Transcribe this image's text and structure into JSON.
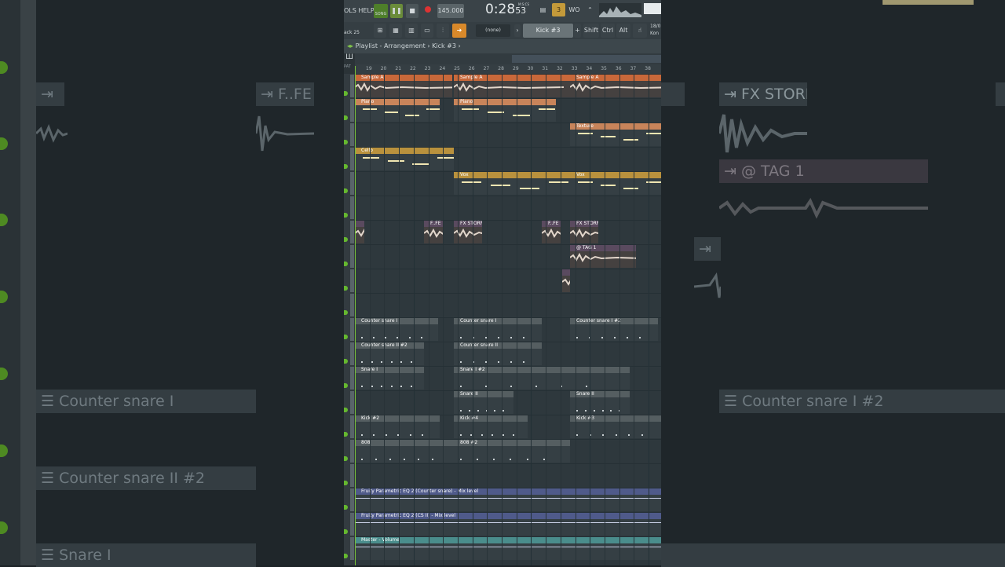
{
  "toolbar": {
    "menu": "OLS HELP",
    "song_mode": "SONG",
    "tempo": "145.000",
    "time": "0:28",
    "time_small": "53",
    "time_unit": "M:S:CS",
    "pattern_num": "3",
    "counter": "WO"
  },
  "toolbar2": {
    "track_label": "ack 25",
    "pattern_select": "(none)",
    "current_pattern": "Kick #3",
    "shift_label": "Shift",
    "ctrl_label": "Ctrl",
    "alt_label": "Alt",
    "corner_text1": "18/0",
    "corner_text2": "Kon"
  },
  "playlist": {
    "title": "Playlist - Arrangement",
    "sep": "›",
    "pattern": "Kick #3",
    "ruler_marks": [
      "19",
      "20",
      "21",
      "22",
      "23",
      "24",
      "25",
      "26",
      "27",
      "28",
      "29",
      "30",
      "31",
      "32",
      "33",
      "34",
      "35",
      "36",
      "37",
      "38"
    ]
  },
  "clips": [
    {
      "name": "Sample A",
      "kind": "audio"
    },
    {
      "name": "Sample A",
      "kind": "audio"
    },
    {
      "name": "Sample A",
      "kind": "audio"
    },
    {
      "name": "Piano",
      "kind": "pattern"
    },
    {
      "name": "Piano",
      "kind": "pattern"
    },
    {
      "name": "Texture",
      "kind": "pattern"
    },
    {
      "name": "Cello",
      "kind": "pattern"
    },
    {
      "name": "Vox",
      "kind": "pattern"
    },
    {
      "name": "Vox",
      "kind": "pattern"
    },
    {
      "name": "",
      "kind": "audio"
    },
    {
      "name": "F..FE",
      "kind": "audio"
    },
    {
      "name": "FX STORM",
      "kind": "audio"
    },
    {
      "name": "F..FE",
      "kind": "audio"
    },
    {
      "name": "FX STORM",
      "kind": "audio"
    },
    {
      "name": "@ TAG 1",
      "kind": "audio"
    },
    {
      "name": "",
      "kind": "audio"
    },
    {
      "name": "Counter snare I",
      "kind": "drum"
    },
    {
      "name": "Counter snare I",
      "kind": "drum"
    },
    {
      "name": "Counter snare I #2",
      "kind": "drum"
    },
    {
      "name": "Counter snare II #2",
      "kind": "drum"
    },
    {
      "name": "Counter snare II",
      "kind": "drum"
    },
    {
      "name": "Snare I",
      "kind": "drum"
    },
    {
      "name": "Snare I #2",
      "kind": "drum"
    },
    {
      "name": "Snare II",
      "kind": "drum"
    },
    {
      "name": "Snare II",
      "kind": "drum"
    },
    {
      "name": "Kick #2",
      "kind": "drum"
    },
    {
      "name": "Kick #4",
      "kind": "drum"
    },
    {
      "name": "Kick #3",
      "kind": "drum"
    },
    {
      "name": "808",
      "kind": "drum"
    },
    {
      "name": "808 #2",
      "kind": "drum"
    },
    {
      "name": "Fruity Parametric EQ 2 (Counter snare) - Mix level",
      "kind": "auto"
    },
    {
      "name": "Fruity Parametric EQ 2 (CS II) - Mix level",
      "kind": "auto"
    },
    {
      "name": "Master - Volume",
      "kind": "auto2"
    }
  ],
  "background_zoom": {
    "labels": [
      "F..FE",
      "FX STORM",
      "@ TAG 1",
      "Counter snare I",
      "Counter snare I #2",
      "Counter snare II #2",
      "Snare I"
    ]
  },
  "colors": {
    "audio_orange": "#c8683a",
    "pattern_orange": "#c8845a",
    "pattern_gold": "#b9913d",
    "audio_purple": "#5a4a5f",
    "drum_grey": "#555e61",
    "auto_blue": "#4f5a8a",
    "auto_teal": "#4a8d8c",
    "accent_green": "#65b82f"
  }
}
